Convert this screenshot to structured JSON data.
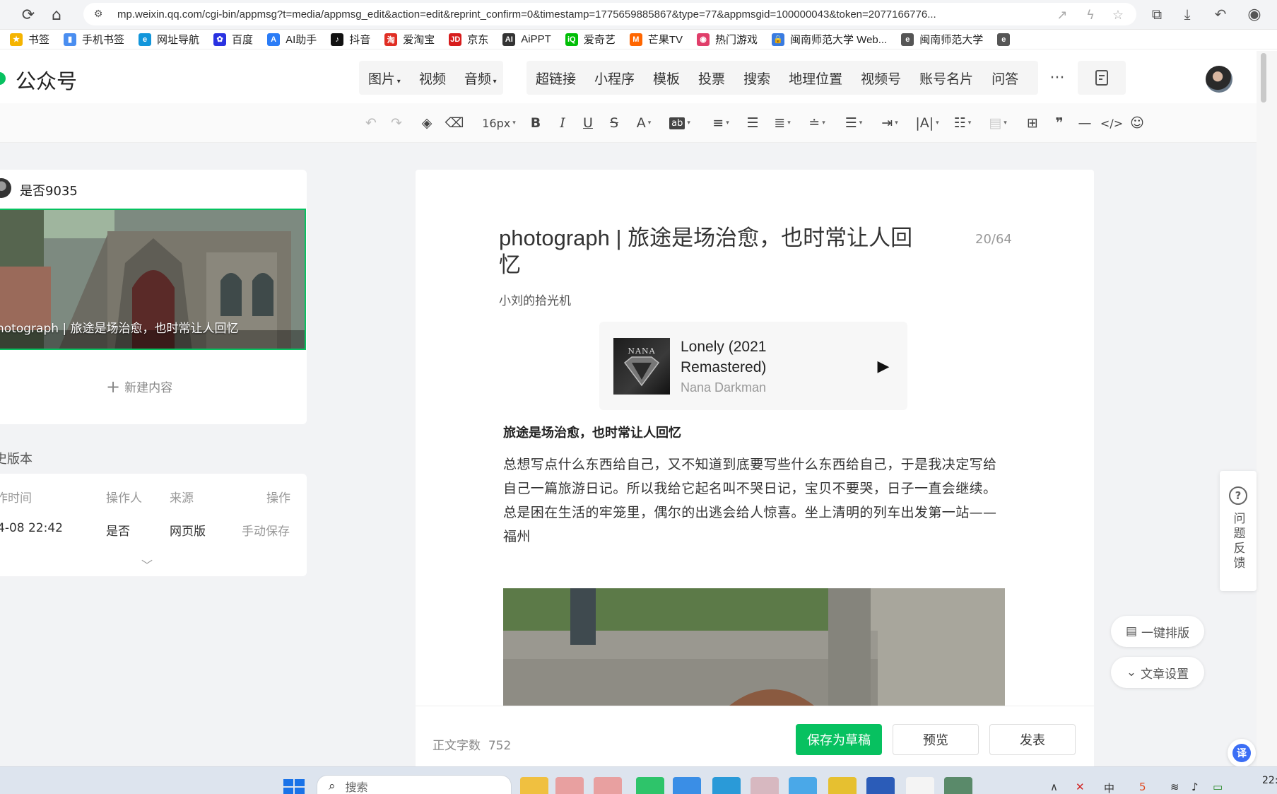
{
  "browser": {
    "url": "mp.weixin.qq.com/cgi-bin/appmsg?t=media/appmsg_edit&action=edit&reprint_confirm=0&timestamp=1775659885867&type=77&appmsgid=100000043&token=2077166776...",
    "bookmarks": [
      {
        "label": "书签",
        "color": "#f5b400",
        "glyph": "★"
      },
      {
        "label": "手机书签",
        "color": "#4a8ef0",
        "glyph": "▮"
      },
      {
        "label": "网址导航",
        "color": "#1296db",
        "glyph": "e"
      },
      {
        "label": "百度",
        "color": "#2932e1",
        "glyph": "✿"
      },
      {
        "label": "AI助手",
        "color": "#2b7cf6",
        "glyph": "A"
      },
      {
        "label": "抖音",
        "color": "#111111",
        "glyph": "♪"
      },
      {
        "label": "爱淘宝",
        "color": "#e02e24",
        "glyph": "淘"
      },
      {
        "label": "京东",
        "color": "#d71c1c",
        "glyph": "JD"
      },
      {
        "label": "AiPPT",
        "color": "#333333",
        "glyph": "AI"
      },
      {
        "label": "爱奇艺",
        "color": "#00be06",
        "glyph": "iQ"
      },
      {
        "label": "芒果TV",
        "color": "#ff6600",
        "glyph": "M"
      },
      {
        "label": "热门游戏",
        "color": "#e03e6a",
        "glyph": "◉"
      },
      {
        "label": "闽南师范大学 Web...",
        "color": "#3a7be0",
        "glyph": "🔒"
      },
      {
        "label": "闽南师范大学",
        "color": "#555555",
        "glyph": "e"
      },
      {
        "label": "",
        "color": "#555555",
        "glyph": "e"
      }
    ]
  },
  "header": {
    "brand": "公众号",
    "insert_group1": [
      {
        "label": "图片",
        "caret": true
      },
      {
        "label": "视频",
        "caret": false
      },
      {
        "label": "音频",
        "caret": true
      }
    ],
    "insert_group2": [
      "超链接",
      "小程序",
      "模板",
      "投票",
      "搜索",
      "地理位置",
      "视频号",
      "账号名片",
      "问答"
    ],
    "more": "···"
  },
  "toolbar": {
    "font_size": "16px"
  },
  "left": {
    "account_name": "是否9035",
    "article_thumb_title": "hotograph | 旅途是场治愈，也时常让人回忆",
    "new_content": "新建内容",
    "history_title": "史版本",
    "history_headers": {
      "time": "作时间",
      "operator": "操作人",
      "source": "来源",
      "action": "操作"
    },
    "history_row": {
      "time": "4-08 22:42",
      "operator": "是否",
      "source": "网页版",
      "action": "手动保存"
    }
  },
  "article": {
    "title": "photograph | 旅途是场治愈，也时常让人回忆",
    "title_count": "20/64",
    "author": "小刘的拾光机",
    "music": {
      "song": "Lonely (2021 Remastered)",
      "artist": "Nana Darkman",
      "album_text": "NANA"
    },
    "subhead": "旅途是场治愈，也时常让人回忆",
    "paragraph": "总想写点什么东西给自己，又不知道到底要写些什么东西给自己，于是我决定写给自己一篇旅游日记。所以我给它起名叫不哭日记，宝贝不要哭，日子一直会继续。总是困在生活的牢笼里，偶尔的出逃会给人惊喜。坐上清明的列车出发第一站——福州"
  },
  "footer": {
    "word_count_label": "正文字数",
    "word_count": "752",
    "save_label": "保存为草稿",
    "preview_label": "预览",
    "publish_label": "发表"
  },
  "side": {
    "feedback_label": "问题反馈",
    "layout_label": "一键排版",
    "settings_label": "文章设置",
    "translate": "译"
  },
  "taskbar": {
    "search_placeholder": "搜索",
    "clock": "22:"
  }
}
